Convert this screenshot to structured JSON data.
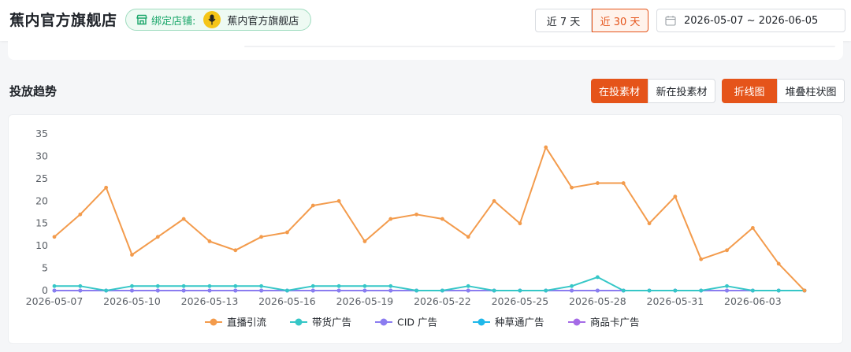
{
  "header": {
    "shop_title": "蕉内官方旗舰店",
    "bind_label": "绑定店铺:",
    "bind_shop_name": "蕉内官方旗舰店",
    "range_7": "近 7 天",
    "range_30": "近 30 天",
    "date_range": "2026-05-07 ~ 2026-06-05"
  },
  "section": {
    "title": "投放趋势",
    "toggle_material": [
      "在投素材",
      "新在投素材"
    ],
    "toggle_chart": [
      "折线图",
      "堆叠柱状图"
    ]
  },
  "colors": {
    "accent": "#e5541a",
    "green": "#1aa66a"
  },
  "chart_data": {
    "type": "line",
    "x": [
      "2026-05-07",
      "2026-05-08",
      "2026-05-09",
      "2026-05-10",
      "2026-05-11",
      "2026-05-12",
      "2026-05-13",
      "2026-05-14",
      "2026-05-15",
      "2026-05-16",
      "2026-05-17",
      "2026-05-18",
      "2026-05-19",
      "2026-05-20",
      "2026-05-21",
      "2026-05-22",
      "2026-05-23",
      "2026-05-24",
      "2026-05-25",
      "2026-05-26",
      "2026-05-27",
      "2026-05-28",
      "2026-05-29",
      "2026-05-30",
      "2026-05-31",
      "2026-06-01",
      "2026-06-02",
      "2026-06-03",
      "2026-06-04",
      "2026-06-05"
    ],
    "x_tick_labels": [
      "2026-05-07",
      "2026-05-10",
      "2026-05-13",
      "2026-05-16",
      "2026-05-19",
      "2026-05-22",
      "2026-05-25",
      "2026-05-28",
      "2026-05-31",
      "2026-06-03"
    ],
    "ylim": [
      0,
      35
    ],
    "y_ticks": [
      0,
      5,
      10,
      15,
      20,
      25,
      30,
      35
    ],
    "grid": false,
    "legend_position": "bottom",
    "series": [
      {
        "name": "直播引流",
        "color": "#f39b4c",
        "values": [
          12,
          17,
          23,
          8,
          12,
          16,
          11,
          9,
          12,
          13,
          19,
          20,
          11,
          16,
          17,
          16,
          12,
          20,
          15,
          32,
          23,
          24,
          24,
          15,
          21,
          7,
          9,
          14,
          6,
          0
        ]
      },
      {
        "name": "带货广告",
        "color": "#36c7c7",
        "values": [
          1,
          1,
          0,
          1,
          1,
          1,
          1,
          1,
          1,
          0,
          1,
          1,
          1,
          1,
          0,
          0,
          1,
          0,
          0,
          0,
          1,
          3,
          0,
          0,
          0,
          0,
          1,
          0,
          0,
          0
        ]
      },
      {
        "name": "CID 广告",
        "color": "#8b7cf0",
        "values": [
          0,
          0,
          0,
          0,
          0,
          0,
          0,
          0,
          0,
          0,
          0,
          0,
          0,
          0,
          0,
          0,
          0,
          0,
          0,
          0,
          0,
          0,
          0,
          0,
          0,
          0,
          0,
          0,
          0,
          0
        ]
      },
      {
        "name": "种草通广告",
        "color": "#1fb8ea",
        "values": [
          0,
          0,
          0,
          0,
          0,
          0,
          0,
          0,
          0,
          0,
          0,
          0,
          0,
          0,
          0,
          0,
          0,
          0,
          0,
          0,
          0,
          0,
          0,
          0,
          0,
          0,
          0,
          0,
          0,
          0
        ]
      },
      {
        "name": "商品卡广告",
        "color": "#a56be6",
        "values": [
          0,
          0,
          0,
          0,
          0,
          0,
          0,
          0,
          0,
          0,
          0,
          0,
          0,
          0,
          0,
          0,
          0,
          0,
          0,
          0,
          0,
          0,
          0,
          0,
          0,
          0,
          0,
          0,
          0,
          0
        ]
      }
    ]
  }
}
